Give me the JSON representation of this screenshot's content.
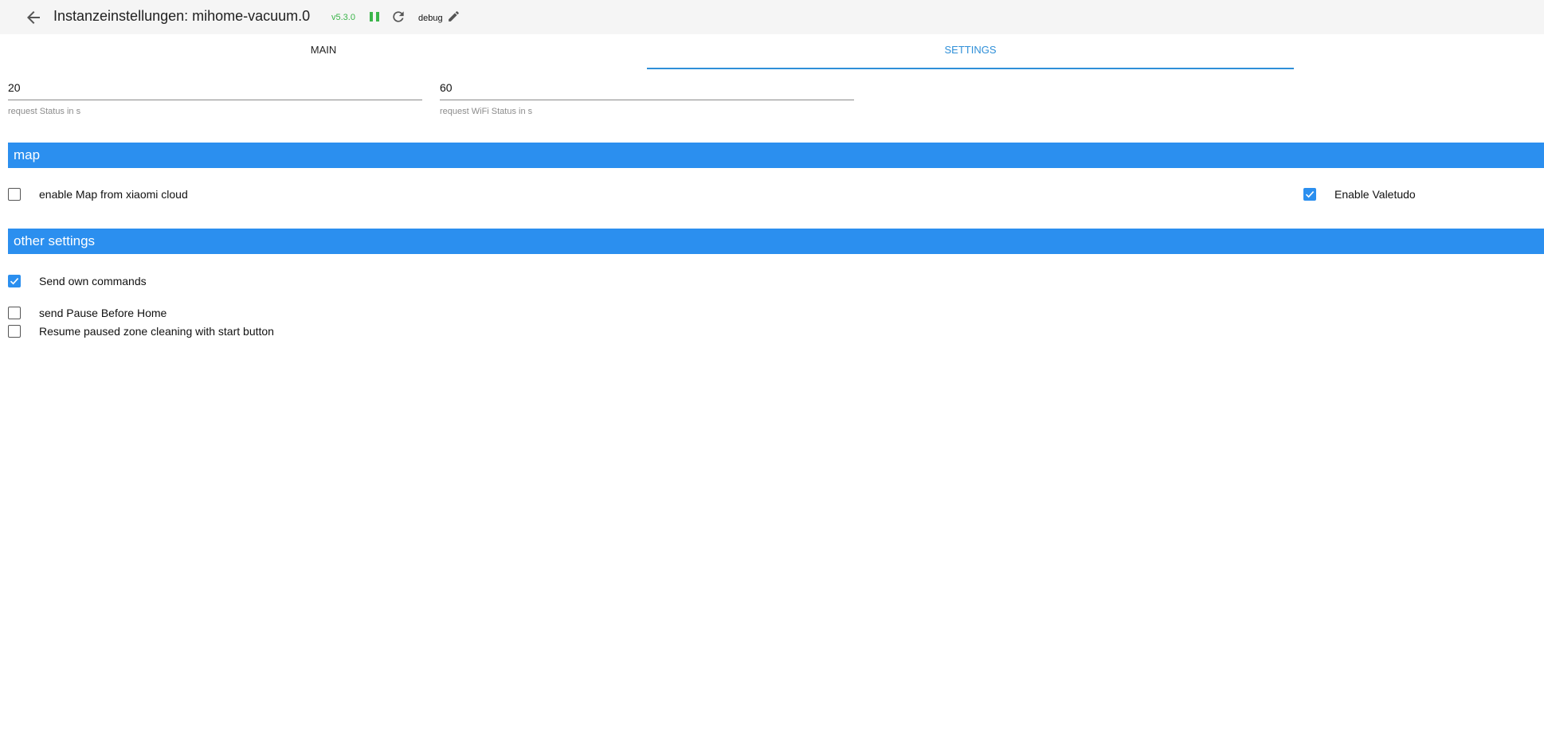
{
  "header": {
    "title": "Instanzeinstellungen: mihome-vacuum.0",
    "version": "v5.3.0",
    "log_level": "debug"
  },
  "tabs": [
    {
      "label": "MAIN",
      "active": false
    },
    {
      "label": "SETTINGS",
      "active": true
    }
  ],
  "fields": {
    "request_status": {
      "value": "20",
      "help": "request Status in s"
    },
    "request_wifi": {
      "value": "60",
      "help": "request WiFi Status in s"
    }
  },
  "sections": {
    "map": {
      "title": "map"
    },
    "other": {
      "title": "other settings"
    }
  },
  "checkboxes": {
    "enable_map_cloud": {
      "label": "enable Map from xiaomi cloud",
      "checked": false
    },
    "enable_valetudo": {
      "label": "Enable Valetudo",
      "checked": true
    },
    "send_own_commands": {
      "label": "Send own commands",
      "checked": true
    },
    "send_pause_before_home": {
      "label": "send Pause Before Home",
      "checked": false
    },
    "resume_paused_zone": {
      "label": "Resume paused zone cleaning with start button",
      "checked": false
    }
  },
  "colors": {
    "accent": "#2b8fef",
    "tab_active": "#2f8fd8",
    "version_green": "#3bb54a"
  },
  "icons": {
    "back": "arrow-left-icon",
    "pause": "pause-icon",
    "reload": "reload-icon",
    "edit": "pencil-icon",
    "check": "checkmark-icon"
  }
}
